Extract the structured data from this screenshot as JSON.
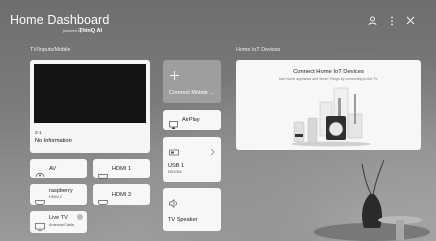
{
  "header": {
    "title": "Home Dashboard",
    "powered_by": "powered by",
    "brand": "ThinQ AI",
    "icons": [
      "account-icon",
      "more-options-icon",
      "close-icon"
    ]
  },
  "sections": {
    "inputs": "TV/Inputs/Mobile",
    "iot": "Home IoT Devices"
  },
  "preview": {
    "channel": "2-1",
    "info": "No Information"
  },
  "cards": {
    "connect_mobile": "Connect Mobile ...",
    "airplay": "AirPlay",
    "usb1": {
      "label": "USB 1",
      "sub": "NS1081"
    },
    "tv_speaker": "TV Speaker"
  },
  "inputs": {
    "av": "AV",
    "hdmi1": "HDMI 1",
    "hdmi2": {
      "label": "raspberry",
      "sub": "HDMI 2"
    },
    "hdmi3": "HDMI 3",
    "live_tv": {
      "label": "Live TV",
      "sub": "Antenna/Cable"
    }
  },
  "iot": {
    "title": "Connect Home IoT Devices",
    "description": "Use Home appliance and Smart Things by connecting to the TV."
  }
}
